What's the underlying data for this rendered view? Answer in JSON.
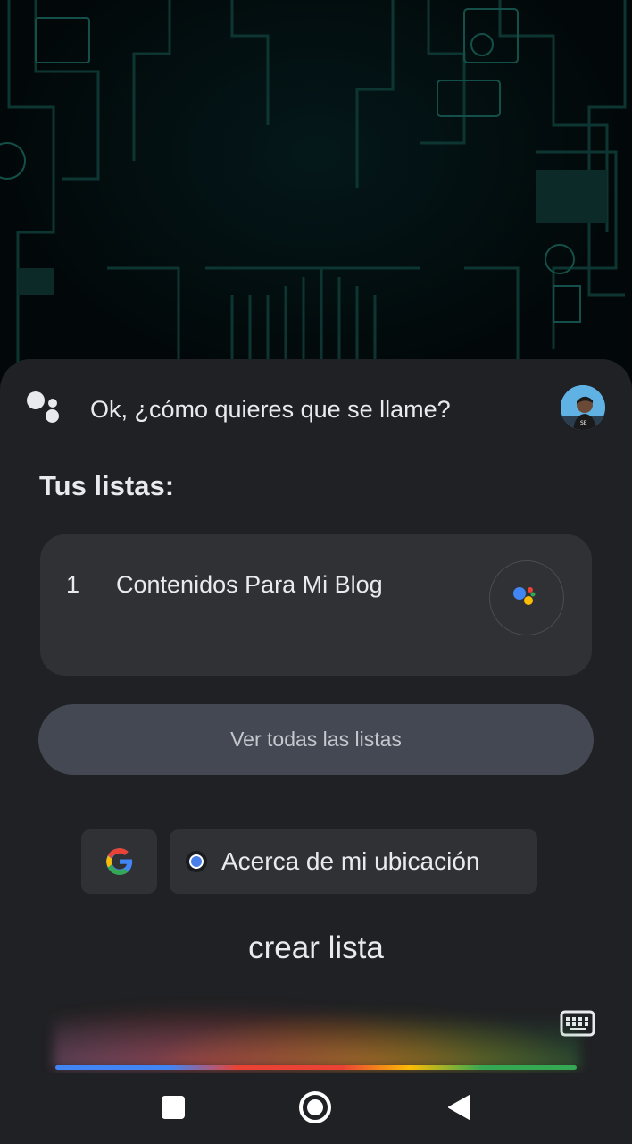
{
  "assistant": {
    "prompt": "Ok, ¿cómo quieres que se llame?"
  },
  "lists": {
    "title": "Tus listas:",
    "items": [
      {
        "index": "1",
        "name": "Contenidos Para Mi Blog"
      }
    ],
    "view_all_label": "Ver todas las listas"
  },
  "suggestions": {
    "location_label": "Acerca de mi ubicación"
  },
  "query": {
    "text": "crear lista"
  },
  "colors": {
    "sheet_background": "#202124",
    "card_background": "#303134",
    "view_all_background": "#434853",
    "google_blue": "#4285f4",
    "google_red": "#ea4335",
    "google_yellow": "#fbbc05",
    "google_green": "#34a853"
  },
  "icons": {
    "assistant": "google-assistant-dots-icon",
    "google": "google-g-icon",
    "location": "location-dot-icon",
    "keyboard": "keyboard-icon",
    "nav_recents": "square-icon",
    "nav_home": "circle-icon",
    "nav_back": "triangle-back-icon"
  }
}
